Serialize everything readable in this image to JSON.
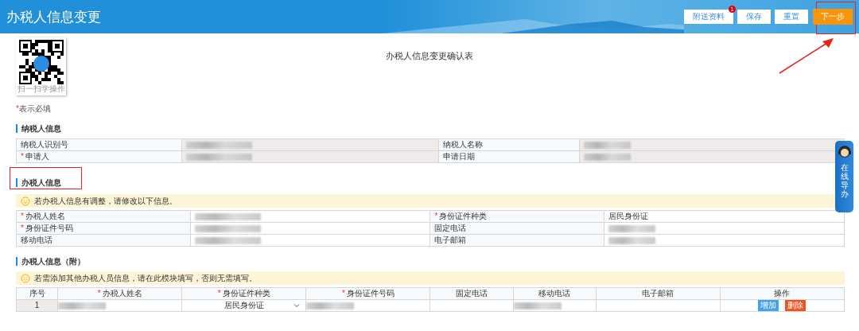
{
  "header": {
    "title": "办税人信息变更",
    "buttons": [
      {
        "label": "附送资料",
        "kind": "plain",
        "badge": "1"
      },
      {
        "label": "保存",
        "kind": "plain"
      },
      {
        "label": "重置",
        "kind": "plain"
      },
      {
        "label": "下一步",
        "kind": "primary"
      }
    ]
  },
  "qr": {
    "caption": "扫一扫学操作"
  },
  "form_title": "办税人信息变更确认表",
  "required_note": {
    "mark": "*",
    "text": "表示必填"
  },
  "sections": [
    {
      "kind": "kv",
      "heading": "纳税人信息",
      "highlighted": false,
      "readonly": true,
      "rows": [
        {
          "cells": [
            {
              "kind": "label",
              "text": "纳税人识别号",
              "required": false
            },
            {
              "kind": "blurred"
            },
            {
              "kind": "label",
              "text": "纳税人名称",
              "required": false
            },
            {
              "kind": "blurred"
            }
          ]
        },
        {
          "cells": [
            {
              "kind": "label",
              "text": "申请人",
              "required": true
            },
            {
              "kind": "blurred"
            },
            {
              "kind": "label",
              "text": "申请日期",
              "required": false
            },
            {
              "kind": "blurred"
            }
          ]
        }
      ]
    },
    {
      "kind": "kv",
      "heading": "办税人信息",
      "highlighted": true,
      "readonly": false,
      "notice": "若办税人信息有调整，请修改以下信息。",
      "rows": [
        {
          "cells": [
            {
              "kind": "label",
              "text": "办税人姓名",
              "required": true
            },
            {
              "kind": "blurred"
            },
            {
              "kind": "label",
              "text": "身份证件种类",
              "required": true
            },
            {
              "kind": "text",
              "text": "居民身份证"
            }
          ]
        },
        {
          "cells": [
            {
              "kind": "label",
              "text": "身份证件号码",
              "required": true
            },
            {
              "kind": "blurred"
            },
            {
              "kind": "label",
              "text": "固定电话",
              "required": false
            },
            {
              "kind": "blurred"
            }
          ]
        },
        {
          "cells": [
            {
              "kind": "label",
              "text": "移动电话",
              "required": false
            },
            {
              "kind": "blurred"
            },
            {
              "kind": "label",
              "text": "电子邮箱",
              "required": false
            },
            {
              "kind": "blurred"
            }
          ]
        }
      ]
    },
    {
      "kind": "grid",
      "heading": "办税人信息（附）",
      "highlighted": false,
      "readonly": false,
      "notice": "若需添加其他办税人员信息，请在此模块填写，否则无需填写。",
      "columns": [
        {
          "label": "序号",
          "required": false
        },
        {
          "label": "办税人姓名",
          "required": true
        },
        {
          "label": "身份证件种类",
          "required": true
        },
        {
          "label": "身份证件号码",
          "required": true
        },
        {
          "label": "固定电话",
          "required": false
        },
        {
          "label": "移动电话",
          "required": false
        },
        {
          "label": "电子邮箱",
          "required": false
        },
        {
          "label": "操作",
          "required": false
        }
      ],
      "rows": [
        {
          "cells": [
            {
              "kind": "index",
              "text": "1"
            },
            {
              "kind": "blurred"
            },
            {
              "kind": "select",
              "text": "居民身份证"
            },
            {
              "kind": "blurred"
            },
            {
              "kind": "empty"
            },
            {
              "kind": "blurred"
            },
            {
              "kind": "empty"
            },
            {
              "kind": "actions",
              "buttons": [
                {
                  "label": "增加",
                  "kind": "add"
                },
                {
                  "label": "删除",
                  "kind": "delete"
                }
              ]
            }
          ]
        }
      ]
    }
  ],
  "side_widget": {
    "label": "在线导办"
  }
}
